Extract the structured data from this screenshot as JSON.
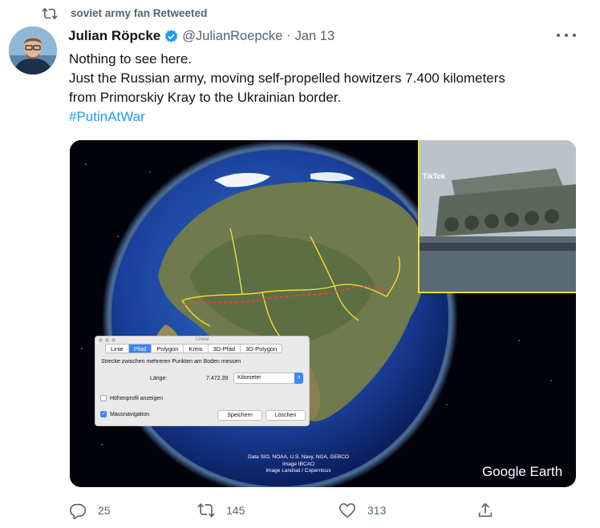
{
  "retweet": {
    "icon": "retweet-icon",
    "text": "soviet army fan Retweeted"
  },
  "author": {
    "name": "Julian Röpcke",
    "handle": "@JulianRoepcke",
    "separator": "·",
    "date": "Jan 13",
    "verified": true
  },
  "tweet": {
    "lines": [
      "Nothing to see here.",
      "Just the Russian army, moving self-propelled howitzers 7.400 kilometers",
      "from Primorskiy Kray to the Ukrainian border."
    ],
    "hashtag": "#PutinAtWar"
  },
  "media": {
    "tiktok_label": "TikTok",
    "dialog": {
      "title": "Lineal",
      "tabs": [
        "Linie",
        "Pfad",
        "Polygon",
        "Kreis",
        "3D-Pfad",
        "3D-Polygon"
      ],
      "active_tab": "Pfad",
      "description": "Strecke zwischen mehreren Punkten am Boden messen",
      "length_label": "Länge:",
      "length_value": "7.472,39",
      "unit": "Kilometer",
      "elevation_label": "Höhenprofil anzeigen",
      "mouse_nav_label": "Mausnavigation",
      "save_button": "Speichern",
      "delete_button": "Löschen"
    },
    "attribution": [
      "Data SIO, NOAA, U.S. Navy, NGA, GEBCO",
      "Image IBCAO",
      "Image Landsat / Copernicus"
    ],
    "logo": "Google Earth"
  },
  "actions": {
    "reply_count": "25",
    "retweet_count": "145",
    "like_count": "313"
  },
  "colors": {
    "accent": "#1d9bf0",
    "muted": "#536471",
    "route": "#f0de30"
  }
}
